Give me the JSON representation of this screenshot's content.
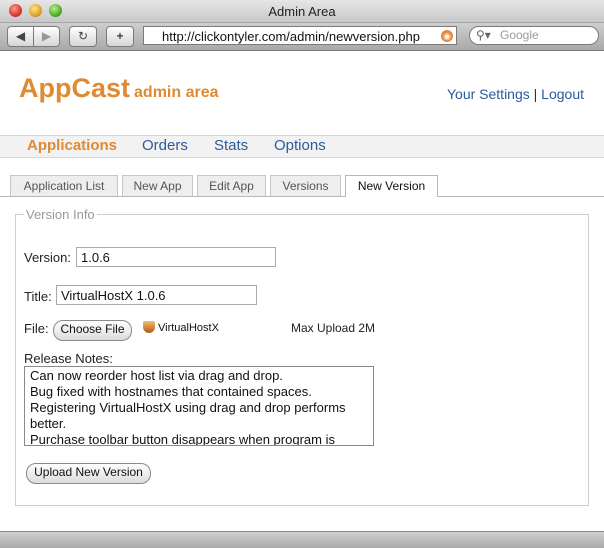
{
  "window": {
    "title": "Admin Area"
  },
  "browser": {
    "back_icon": "◀",
    "forward_icon": "▶",
    "reload_icon": "↻",
    "addtab_icon": "+",
    "url": "http://clickontyler.com/admin/newversion.php",
    "search_placeholder": "Google"
  },
  "header": {
    "brand": "AppCast",
    "brand_sub": "admin area",
    "settings_link": "Your Settings",
    "separator": "|",
    "logout_link": "Logout"
  },
  "mainnav": {
    "items": [
      {
        "label": "Applications",
        "active": true
      },
      {
        "label": "Orders"
      },
      {
        "label": "Stats"
      },
      {
        "label": "Options"
      }
    ]
  },
  "subtabs": {
    "items": [
      {
        "label": "Application List"
      },
      {
        "label": "New App"
      },
      {
        "label": "Edit App"
      },
      {
        "label": "Versions"
      },
      {
        "label": "New Version",
        "active": true
      }
    ]
  },
  "form": {
    "legend": "Version Info",
    "version_label": "Version:",
    "version_value": "1.0.6",
    "title_label": "Title:",
    "title_value": "VirtualHostX 1.0.6",
    "file_label": "File:",
    "choose_file_button": "Choose File",
    "file_name": "VirtualHostX",
    "max_upload": "Max Upload 2M",
    "release_notes_label": "Release Notes:",
    "release_notes": [
      "Can now reorder host list via drag and drop.",
      "Bug fixed with hostnames that contained spaces.",
      "Registering VirtualHostX using drag and drop performs",
      "better.",
      "Purchase toolbar button disappears when program is"
    ],
    "submit_button": "Upload New Version"
  },
  "colors": {
    "brand_orange": "#e08a32",
    "link_blue": "#2c5a9c"
  }
}
